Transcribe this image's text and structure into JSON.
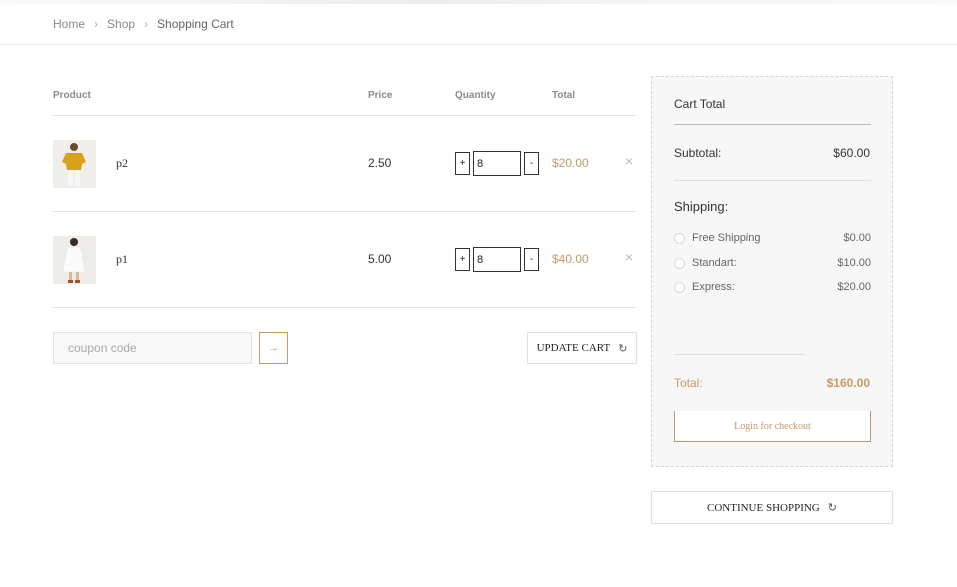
{
  "breadcrumb": {
    "items": [
      "Home",
      "Shop",
      "Shopping Cart"
    ],
    "separator": "›"
  },
  "table": {
    "headers": {
      "product": "Product",
      "price": "Price",
      "quantity": "Quantity",
      "total": "Total"
    },
    "rows": [
      {
        "name": "p2",
        "price": "2.50",
        "qty": "8",
        "total": "$20.00",
        "plus": "+",
        "minus": "-",
        "remove": "×",
        "thumb_icon": "yellow-shirt-product-image"
      },
      {
        "name": "p1",
        "price": "5.00",
        "qty": "8",
        "total": "$40.00",
        "plus": "+",
        "minus": "-",
        "remove": "×",
        "thumb_icon": "white-dress-product-image"
      }
    ]
  },
  "coupon": {
    "placeholder": "coupon code",
    "apply_icon": "→"
  },
  "update_cart": {
    "label": "UPDATE CART",
    "icon": "↻"
  },
  "cart_total": {
    "title": "Cart Total",
    "subtotal_label": "Subtotal:",
    "subtotal_value": "$60.00",
    "shipping_label": "Shipping:",
    "shipping_options": [
      {
        "label": "Free Shipping",
        "amount": "$0.00"
      },
      {
        "label": "Standart:",
        "amount": "$10.00"
      },
      {
        "label": "Express:",
        "amount": "$20.00"
      }
    ],
    "total_label": "Total:",
    "total_value": "$160.00",
    "checkout_label": "Login for checkout"
  },
  "continue_shopping": {
    "label": "CONTINUE SHOPPING",
    "icon": "↻"
  },
  "colors": {
    "accent": "#c79a66",
    "panel_bg": "#f7f7f7"
  }
}
